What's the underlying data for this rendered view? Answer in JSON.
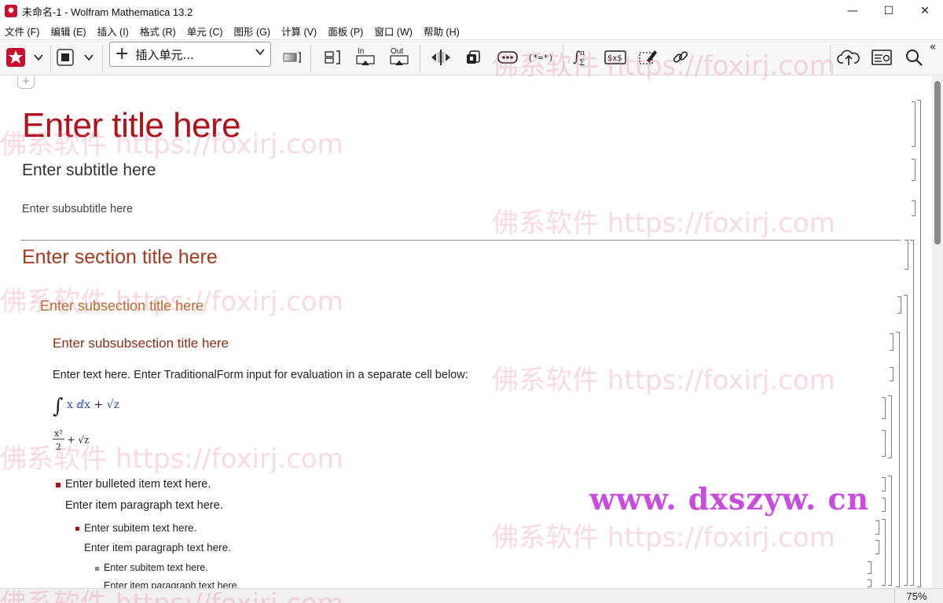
{
  "window": {
    "title": "未命名-1 - Wolfram Mathematica 13.2",
    "minimize_glyph": "—",
    "maximize_glyph": "☐",
    "close_glyph": "✕"
  },
  "menu": [
    "文件 (F)",
    "编辑 (E)",
    "插入 (I)",
    "格式 (R)",
    "单元 (C)",
    "图形 (G)",
    "计算 (V)",
    "面板 (P)",
    "窗口 (W)",
    "帮助 (H)"
  ],
  "toolbar": {
    "insert_cell_label": "插入单元...",
    "insert_cell_plus": "+",
    "in_label": "In",
    "out_label": "Out",
    "dollar_label": "$x$",
    "ellipsis_label": "•••",
    "template_label": "(*=*)"
  },
  "notebook": {
    "title": "Enter title here",
    "subtitle": "Enter subtitle here",
    "subsubtitle": "Enter subsubtitle here",
    "section": "Enter section title here",
    "subsection": "Enter subsection title here",
    "subsubsection": "Enter subsubsection title here",
    "text": "Enter text here. Enter TraditionalForm input for evaluation in a separate cell below:",
    "input": {
      "integral": "∫",
      "var": "x",
      "dx": "ⅆx",
      "plus": "+",
      "sqrt": "√z"
    },
    "output": {
      "numerator": "x²",
      "denominator": "2",
      "plus": "+",
      "sqrt": "√z"
    },
    "bulleted_item": "Enter bulleted item text here.",
    "item_paragraph": "Enter item paragraph text here.",
    "subitem": "Enter subitem text here.",
    "subitem_paragraph": "Enter item paragraph text here.",
    "subsubitem": "Enter subitem text here.",
    "subsubitem_paragraph": "Enter item paragraph text here."
  },
  "status": {
    "zoom": "75%"
  },
  "watermarks": {
    "foxirj": "佛系软件 https://foxirj.com",
    "site": "www. dxszyw. cn"
  },
  "colors": {
    "title": "#b0121b",
    "section": "#a33a1f",
    "subsection": "#bd6a2a",
    "subsubsection": "#8a2f1a",
    "accent": "#c8102e"
  }
}
